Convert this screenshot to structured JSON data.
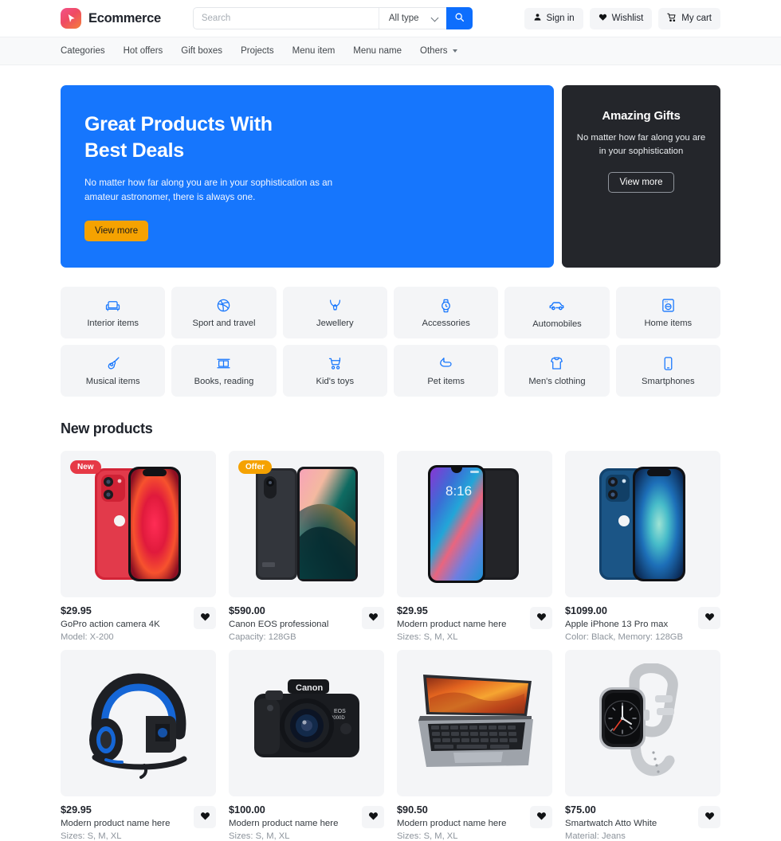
{
  "header": {
    "brand_name": "Ecommerce",
    "logo_icon": "cursor-logo-icon",
    "search": {
      "placeholder": "Search",
      "value": "",
      "type_selected": "All type",
      "search_icon": "search-icon"
    },
    "actions": [
      {
        "label": "Sign in",
        "icon": "user-icon"
      },
      {
        "label": "Wishlist",
        "icon": "heart-icon"
      },
      {
        "label": "My cart",
        "icon": "cart-icon"
      }
    ]
  },
  "nav": {
    "items": [
      {
        "label": "Categories",
        "has_caret": false
      },
      {
        "label": "Hot offers",
        "has_caret": false
      },
      {
        "label": "Gift boxes",
        "has_caret": false
      },
      {
        "label": "Projects",
        "has_caret": false
      },
      {
        "label": "Menu item",
        "has_caret": false
      },
      {
        "label": "Menu name",
        "has_caret": false
      },
      {
        "label": "Others",
        "has_caret": true
      }
    ]
  },
  "hero": {
    "main": {
      "title_line1": "Great Products With",
      "title_line2": "Best Deals",
      "subtitle": "No matter how far along you are in your sophistication as an amateur astronomer, there is always one.",
      "cta": "View more",
      "bg_color": "#1676fd",
      "cta_color": "#f5a201"
    },
    "side": {
      "title": "Amazing Gifts",
      "subtitle": "No matter how far along you are in your sophistication",
      "cta": "View more",
      "bg_color": "#24262b"
    }
  },
  "categories": {
    "accent_color": "#1676fd",
    "items": [
      {
        "label": "Interior items",
        "icon": "armchair-icon"
      },
      {
        "label": "Sport and travel",
        "icon": "basketball-icon"
      },
      {
        "label": "Jewellery",
        "icon": "necklace-icon"
      },
      {
        "label": "Accessories",
        "icon": "watch-icon"
      },
      {
        "label": "Automobiles",
        "icon": "car-icon"
      },
      {
        "label": "Home items",
        "icon": "washing-machine-icon"
      },
      {
        "label": "Musical items",
        "icon": "guitar-icon"
      },
      {
        "label": "Books, reading",
        "icon": "book-icon"
      },
      {
        "label": "Kid's toys",
        "icon": "stroller-icon"
      },
      {
        "label": "Pet items",
        "icon": "dog-icon"
      },
      {
        "label": "Men's clothing",
        "icon": "shirt-icon"
      },
      {
        "label": "Smartphones",
        "icon": "smartphone-icon"
      }
    ]
  },
  "products_section": {
    "title": "New products",
    "items": [
      {
        "price": "$29.95",
        "name": "GoPro action camera 4K",
        "attribute": "Model: X-200",
        "badge": {
          "label": "New",
          "type": "new"
        },
        "image": "red-iphone-pair",
        "fav_icon": "heart-icon"
      },
      {
        "price": "$590.00",
        "name": "Canon EOS professional",
        "attribute": "Capacity: 128GB",
        "badge": {
          "label": "Offer",
          "type": "offer"
        },
        "image": "dark-tablet-gradient",
        "fav_icon": "heart-icon"
      },
      {
        "price": "$29.95",
        "name": "Modern product name here",
        "attribute": "Sizes: S, M, XL",
        "badge": null,
        "image": "android-phone-pair",
        "fav_icon": "heart-icon"
      },
      {
        "price": "$1099.00",
        "name": "Apple iPhone 13 Pro max",
        "attribute": "Color: Black, Memory: 128GB",
        "badge": null,
        "image": "blue-iphone-pair",
        "fav_icon": "heart-icon"
      },
      {
        "price": "$29.95",
        "name": "Modern product name here",
        "attribute": "Sizes: S, M, XL",
        "badge": null,
        "image": "gaming-headset",
        "fav_icon": "heart-icon"
      },
      {
        "price": "$100.00",
        "name": "Modern product name here",
        "attribute": "Sizes: S, M, XL",
        "badge": null,
        "image": "canon-dslr-camera",
        "fav_icon": "heart-icon"
      },
      {
        "price": "$90.50",
        "name": "Modern product name here",
        "attribute": "Sizes: S, M, XL",
        "badge": null,
        "image": "open-laptop",
        "fav_icon": "heart-icon"
      },
      {
        "price": "$75.00",
        "name": "Smartwatch Atto White",
        "attribute": "Material: Jeans",
        "badge": null,
        "image": "grey-smartwatch",
        "fav_icon": "heart-icon"
      }
    ]
  }
}
